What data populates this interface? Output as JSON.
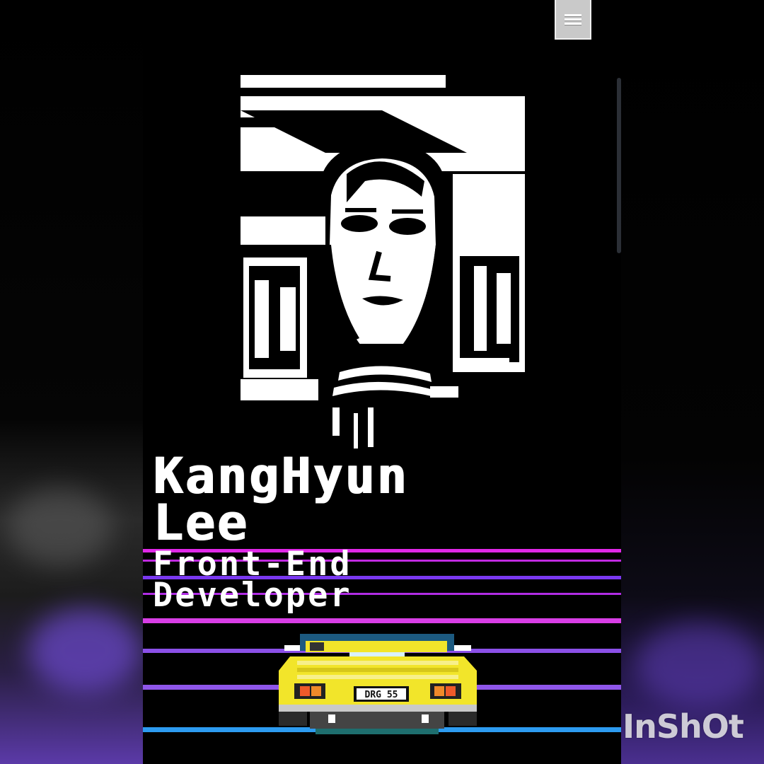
{
  "profile": {
    "name_line1": "KangHyun",
    "name_line2": "Lee",
    "role_line1": "Front-End",
    "role_line2": "Developer"
  },
  "car": {
    "plate": "DRG 55"
  },
  "menu": {
    "icon": "hamburger-menu-icon"
  },
  "watermark": {
    "text": "InShOt"
  },
  "colors": {
    "background": "#000000",
    "stripe_magenta": "#e028e8",
    "stripe_purple": "#8a4fe6",
    "stripe_blue": "#2d9bf0",
    "car_yellow": "#f2e52a"
  }
}
